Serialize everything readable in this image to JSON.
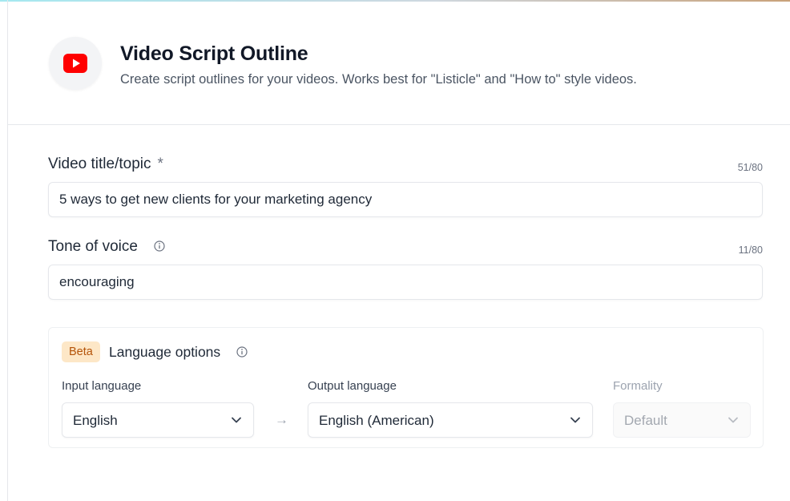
{
  "header": {
    "title": "Video Script Outline",
    "subtitle": "Create script outlines for your videos. Works best for \"Listicle\" and \"How to\" style videos.",
    "logo_icon": "youtube-play-icon",
    "logo_color": "#ff0000"
  },
  "fields": {
    "video_title": {
      "label": "Video title/topic",
      "required_marker": "*",
      "counter": "51/80",
      "value": "5 ways to get new clients for your marketing agency"
    },
    "tone": {
      "label": "Tone of voice",
      "counter": "11/80",
      "value": "encouraging",
      "info_icon": "info-icon"
    }
  },
  "language_options": {
    "badge": "Beta",
    "title": "Language options",
    "input_language": {
      "label": "Input language",
      "value": "English"
    },
    "arrow": "→",
    "output_language": {
      "label": "Output language",
      "value": "English (American)"
    },
    "formality": {
      "label": "Formality",
      "value": "Default",
      "disabled": true
    }
  },
  "colors": {
    "badge_bg": "#fde7c7",
    "badge_text": "#b45309",
    "border": "#e5e7eb"
  }
}
